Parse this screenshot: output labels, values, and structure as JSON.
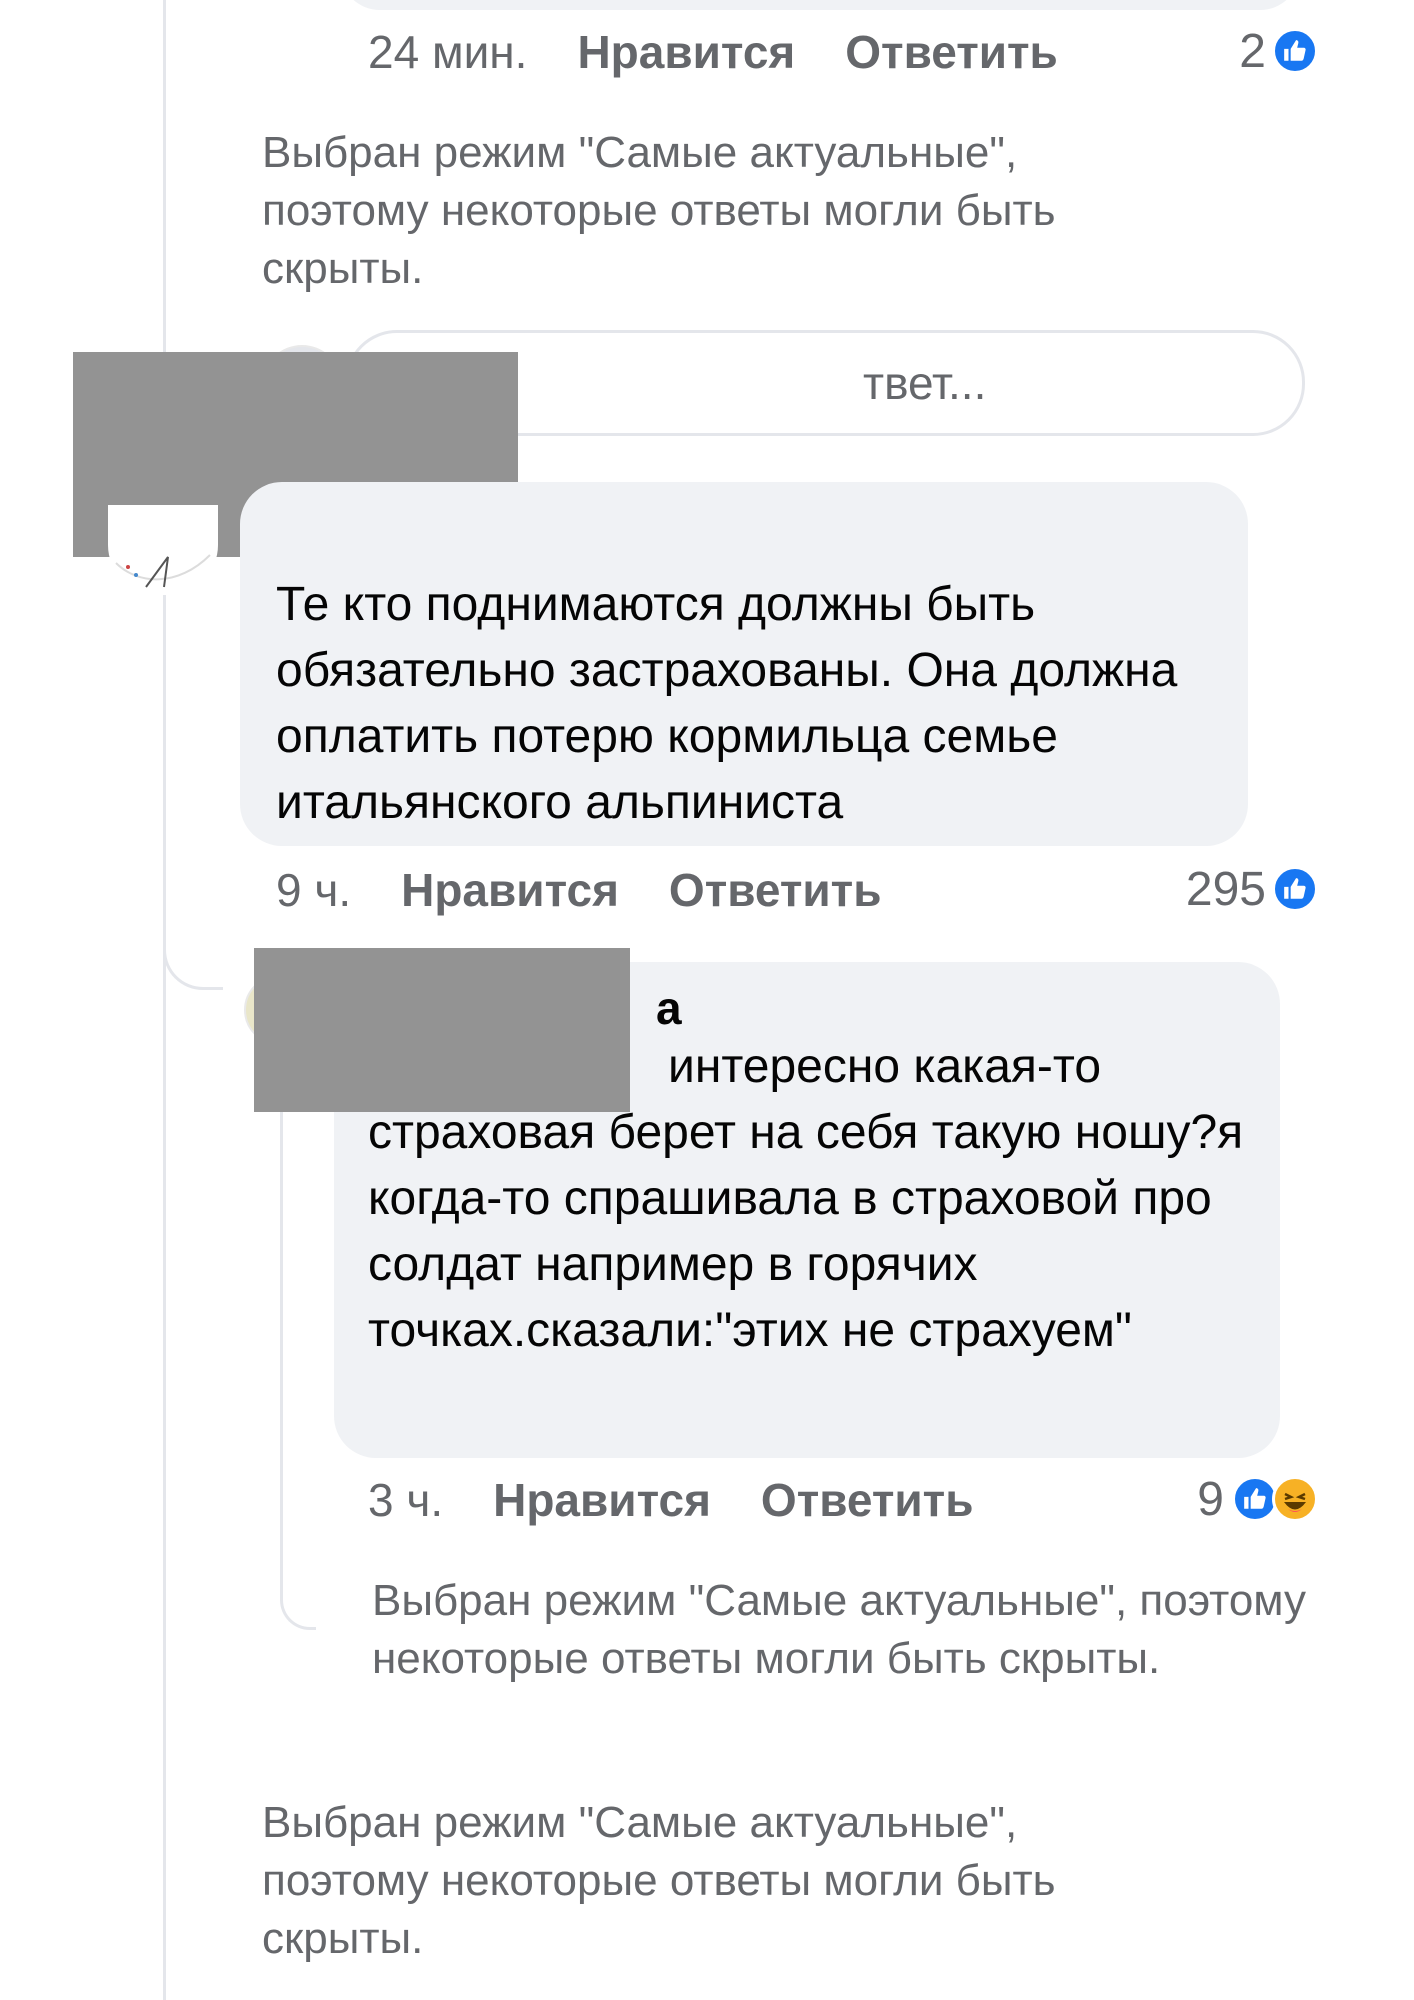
{
  "top_comment": {
    "time": "24 мин.",
    "like_label": "Нравится",
    "reply_label": "Ответить",
    "reaction_count": "2",
    "reactions": [
      "like-icon"
    ]
  },
  "notice_1": "Выбран режим \"Самые актуальные\", поэтому некоторые ответы могли быть скрыты.",
  "reply_input": {
    "placeholder_visible": "твет..."
  },
  "comment_2": {
    "text": "Те кто поднимаются должны быть обязательно застрахованы. Она должна оплатить потерю кормильца семье итальянского альпиниста",
    "time": "9 ч.",
    "like_label": "Нравится",
    "reply_label": "Ответить",
    "reaction_count": "295",
    "reactions": [
      "like-icon"
    ]
  },
  "reply_3": {
    "author_visible": "а",
    "text_line_1": "интересно какая-то",
    "text_rest": "страховая берет на себя такую ношу?я когда-то спрашивала в страховой про солдат например в горячих точках.сказали:\"этих не страхуем\"",
    "time": "3 ч.",
    "like_label": "Нравится",
    "reply_label": "Ответить",
    "reaction_count": "9",
    "reactions": [
      "like-icon",
      "haha-icon"
    ]
  },
  "notice_2": "Выбран режим \"Самые актуальные\", поэтому некоторые ответы могли быть скрыты.",
  "notice_3": "Выбран режим \"Самые актуальные\", поэтому некоторые ответы могли быть скрыты.",
  "colors": {
    "meta_text": "#65676b",
    "bubble_bg": "#f0f2f5",
    "like_blue": "#1877f2",
    "haha_yellow": "#f7b125",
    "redaction_gray": "#939393"
  }
}
